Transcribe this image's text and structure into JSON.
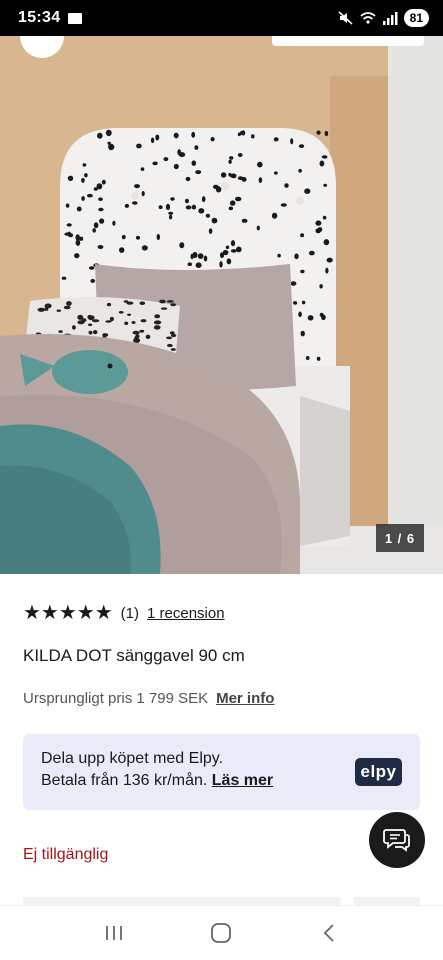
{
  "status_bar": {
    "time": "15:34",
    "battery": "81",
    "icons": [
      "notification-icon",
      "mute-icon",
      "wifi-icon",
      "signal-icon"
    ]
  },
  "gallery": {
    "counter": "1 / 6",
    "colors": {
      "wall": "#d8b690",
      "headboard": "#f3f1ef",
      "dots": "#1a1a1a",
      "duvet": "#b9a7a4",
      "throw": "#4f8c8b"
    }
  },
  "product": {
    "stars": "★★★★★",
    "rating_count": "(1)",
    "review_link": "1 recension",
    "title": "KILDA DOT sänggavel 90 cm",
    "original_price_text": "Ursprungligt pris 1 799 SEK",
    "more_info_link": "Mer info",
    "availability": "Ej tillgänglig"
  },
  "elpy": {
    "line1": "Dela upp köpet med Elpy.",
    "line2_text": "Betala från 136 kr/mån.",
    "read_more_link": "Läs mer",
    "logo_text": "elpy"
  },
  "colors": {
    "accent_red": "#a3151a",
    "elpy_bg": "#e9ecf8",
    "elpy_logo_bg": "#1f2a44"
  }
}
